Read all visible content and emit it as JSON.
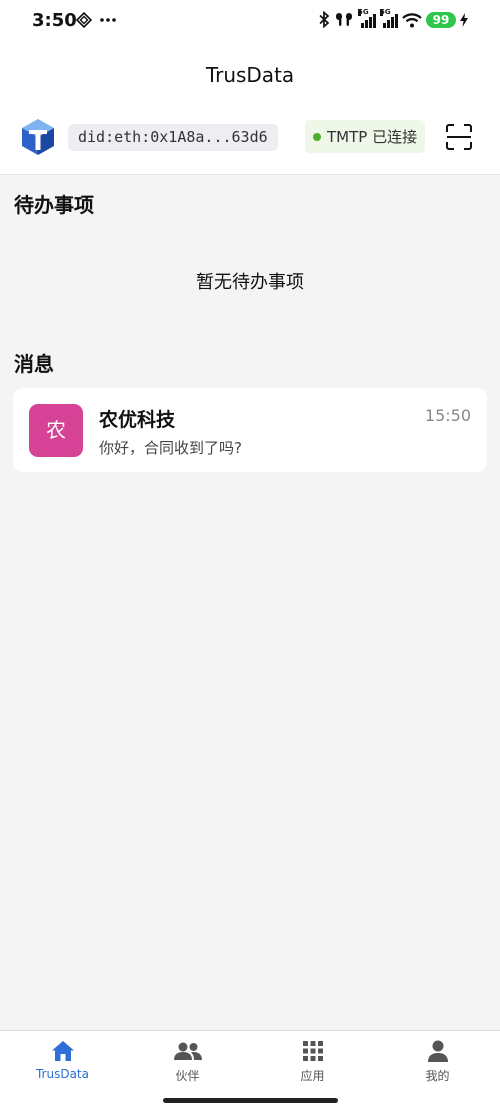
{
  "status_bar": {
    "time": "3:50",
    "battery": "99",
    "network_tag_1": "5G",
    "network_tag_2": "5G"
  },
  "header": {
    "title": "TrusData",
    "did": "did:eth:0x1A8a...63d6",
    "connection_status": "TMTP 已连接"
  },
  "todo": {
    "title": "待办事项",
    "empty_text": "暂无待办事项"
  },
  "messages": {
    "title": "消息",
    "items": [
      {
        "avatar_text": "农",
        "name": "农优科技",
        "preview": "你好，合同收到了吗?",
        "time": "15:50",
        "avatar_color": "#d64396"
      }
    ]
  },
  "nav": {
    "items": [
      {
        "label": "TrusData",
        "icon": "home-icon",
        "active": true
      },
      {
        "label": "伙伴",
        "icon": "people-icon",
        "active": false
      },
      {
        "label": "应用",
        "icon": "grid-icon",
        "active": false
      },
      {
        "label": "我的",
        "icon": "person-icon",
        "active": false
      }
    ]
  },
  "colors": {
    "accent": "#2d6fd6",
    "connected_dot": "#4caf2a",
    "battery": "#2fc64c"
  }
}
